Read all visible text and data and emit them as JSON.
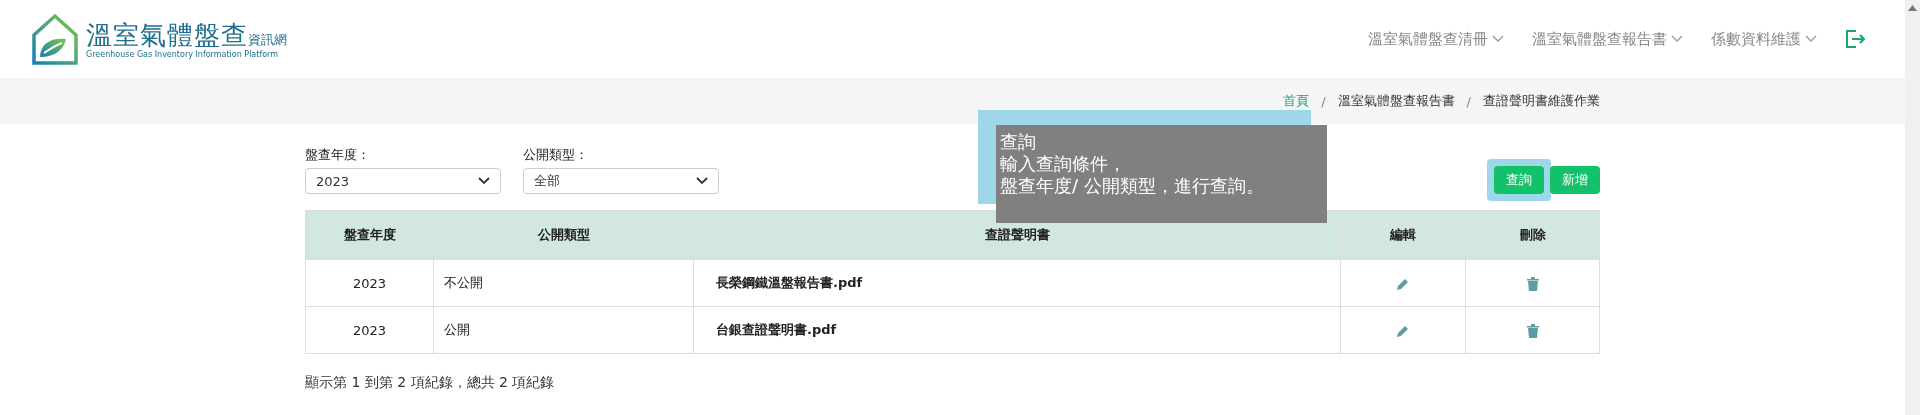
{
  "logo": {
    "title": "溫室氣體盤查",
    "suffix": "資訊網",
    "subtitle": "Greenhouse Gas Inventory Information Platform"
  },
  "nav": [
    {
      "label": "溫室氣體盤查清冊"
    },
    {
      "label": "溫室氣體盤查報告書"
    },
    {
      "label": "係數資料維護"
    }
  ],
  "breadcrumb_separator": "/",
  "breadcrumb": [
    {
      "label": "首頁",
      "link": true
    },
    {
      "label": "溫室氣體盤查報告書",
      "link": false
    },
    {
      "label": "查證聲明書維護作業",
      "link": false
    }
  ],
  "filters": [
    {
      "label": "盤查年度：",
      "value": "2023"
    },
    {
      "label": "公開類型：",
      "value": "全部"
    }
  ],
  "buttons": [
    {
      "label": "查詢",
      "highlighted": true
    },
    {
      "label": "新增",
      "highlighted": false
    }
  ],
  "tour": {
    "title": "查詢",
    "lines": [
      "輸入查詢條件，",
      "盤查年度/ 公開類型，進行查詢。"
    ]
  },
  "table": {
    "columns": [
      "盤查年度",
      "公開類型",
      "查證聲明書",
      "編輯",
      "刪除"
    ],
    "rows": [
      {
        "year": "2023",
        "type": "不公開",
        "file": "長榮鋼鐵溫盤報告書.pdf"
      },
      {
        "year": "2023",
        "type": "公開",
        "file": "台銀查證聲明書.pdf"
      }
    ]
  },
  "summary": "顯示第 1 到第 2 項紀錄，總共 2 項紀錄"
}
